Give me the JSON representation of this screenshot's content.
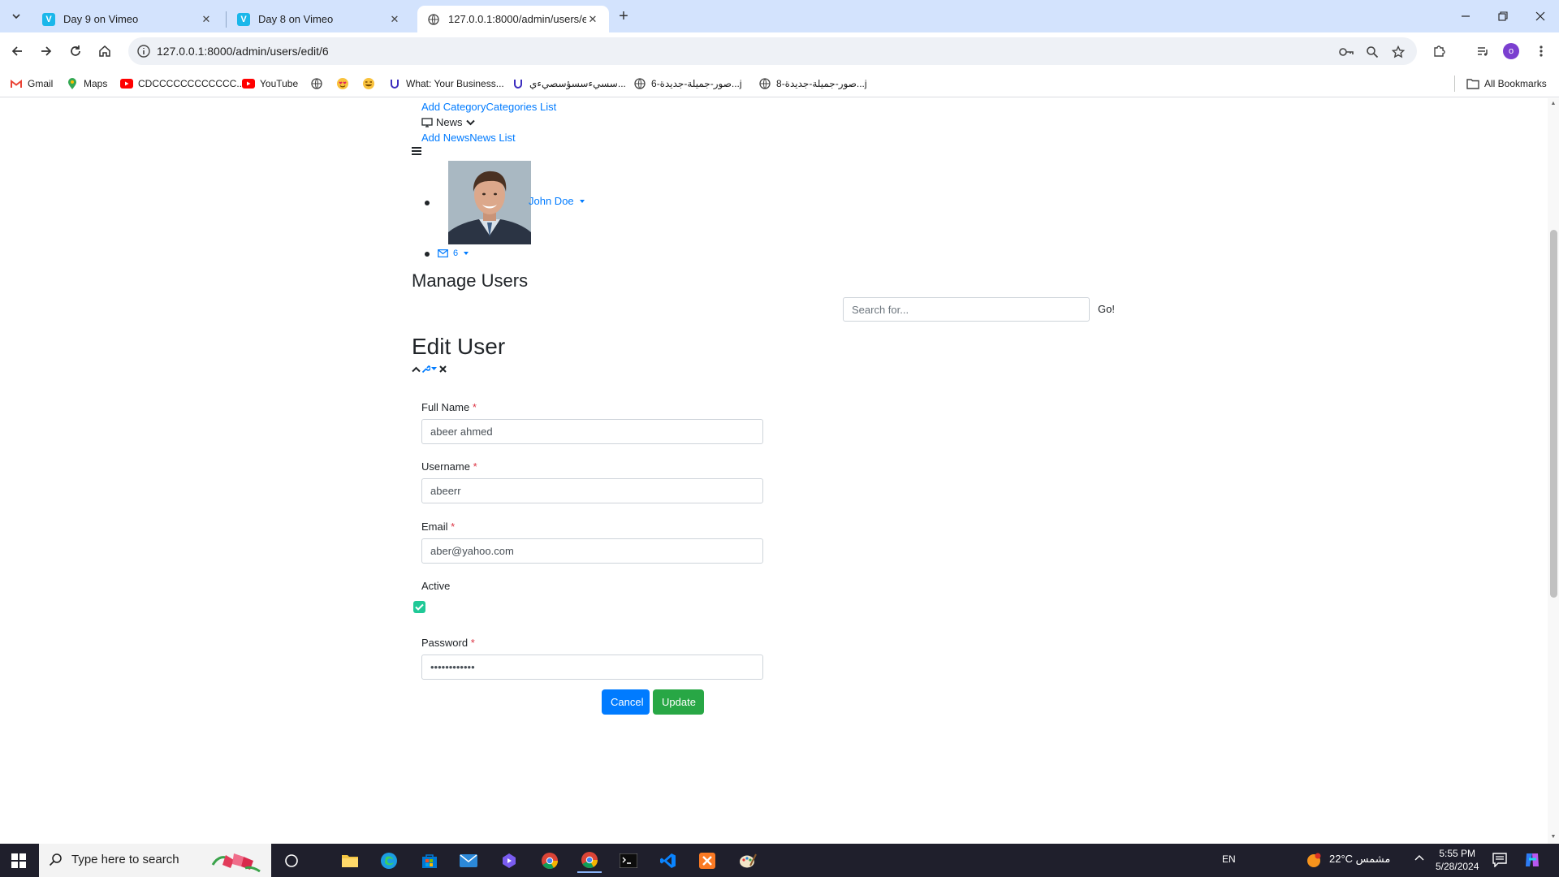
{
  "browser": {
    "tabs": [
      {
        "title": "Day 9 on Vimeo",
        "favicon": "vimeo-icon",
        "active": false
      },
      {
        "title": "Day 8 on Vimeo",
        "favicon": "vimeo-icon",
        "active": false
      },
      {
        "title": "127.0.0.1:8000/admin/users/edi",
        "favicon": "globe-icon",
        "active": true
      }
    ],
    "url": "127.0.0.1:8000/admin/users/edit/6",
    "profile_initial": "o",
    "bookmarks": [
      {
        "label": "Gmail",
        "icon": "gmail-icon"
      },
      {
        "label": "Maps",
        "icon": "maps-pin-icon"
      },
      {
        "label": "CDCCCCCCCCCCCC...",
        "icon": "youtube-icon"
      },
      {
        "label": "YouTube",
        "icon": "youtube-icon"
      },
      {
        "label": "",
        "icon": "globe-icon"
      },
      {
        "label": "",
        "icon": "emoji-hearts-icon"
      },
      {
        "label": "",
        "icon": "emoji-laugh-icon"
      },
      {
        "label": "What: Your Business...",
        "icon": "u-logo-icon"
      },
      {
        "label": "سسيءسسؤسصيءي...",
        "icon": "u-logo-icon"
      },
      {
        "label": "صور-جميلة-جديدة-6...j",
        "icon": "globe-icon"
      },
      {
        "label": "صور-جميلة-جديدة-8...j",
        "icon": "globe-icon"
      }
    ],
    "all_bookmarks": "All Bookmarks"
  },
  "nav": {
    "add_category": "Add Category",
    "categories_list": "Categories List",
    "news": "News",
    "add_news": "Add News",
    "news_list": "News List",
    "user_name": "John Doe",
    "messages_count": "6"
  },
  "page": {
    "title": "Manage Users",
    "search_placeholder": "Search for...",
    "go": "Go!",
    "section_title": "Edit User"
  },
  "form": {
    "full_name": {
      "label": "Full Name",
      "value": "abeer ahmed"
    },
    "username": {
      "label": "Username",
      "value": "abeerr"
    },
    "email": {
      "label": "Email",
      "value": "aber@yahoo.com"
    },
    "active": {
      "label": "Active",
      "checked": true
    },
    "password": {
      "label": "Password",
      "value": "abcdefghijkl"
    },
    "required_mark": "*",
    "cancel": "Cancel",
    "update": "Update"
  },
  "taskbar": {
    "search_placeholder": "Type here to search",
    "language": "EN",
    "weather": "22°C مشمس",
    "time": "5:55 PM",
    "date": "5/28/2024"
  },
  "colors": {
    "link": "#007bff",
    "cancel_button": "#007bff",
    "update_button": "#28a745",
    "checkbox": "#20c997",
    "required": "#dc3545"
  }
}
